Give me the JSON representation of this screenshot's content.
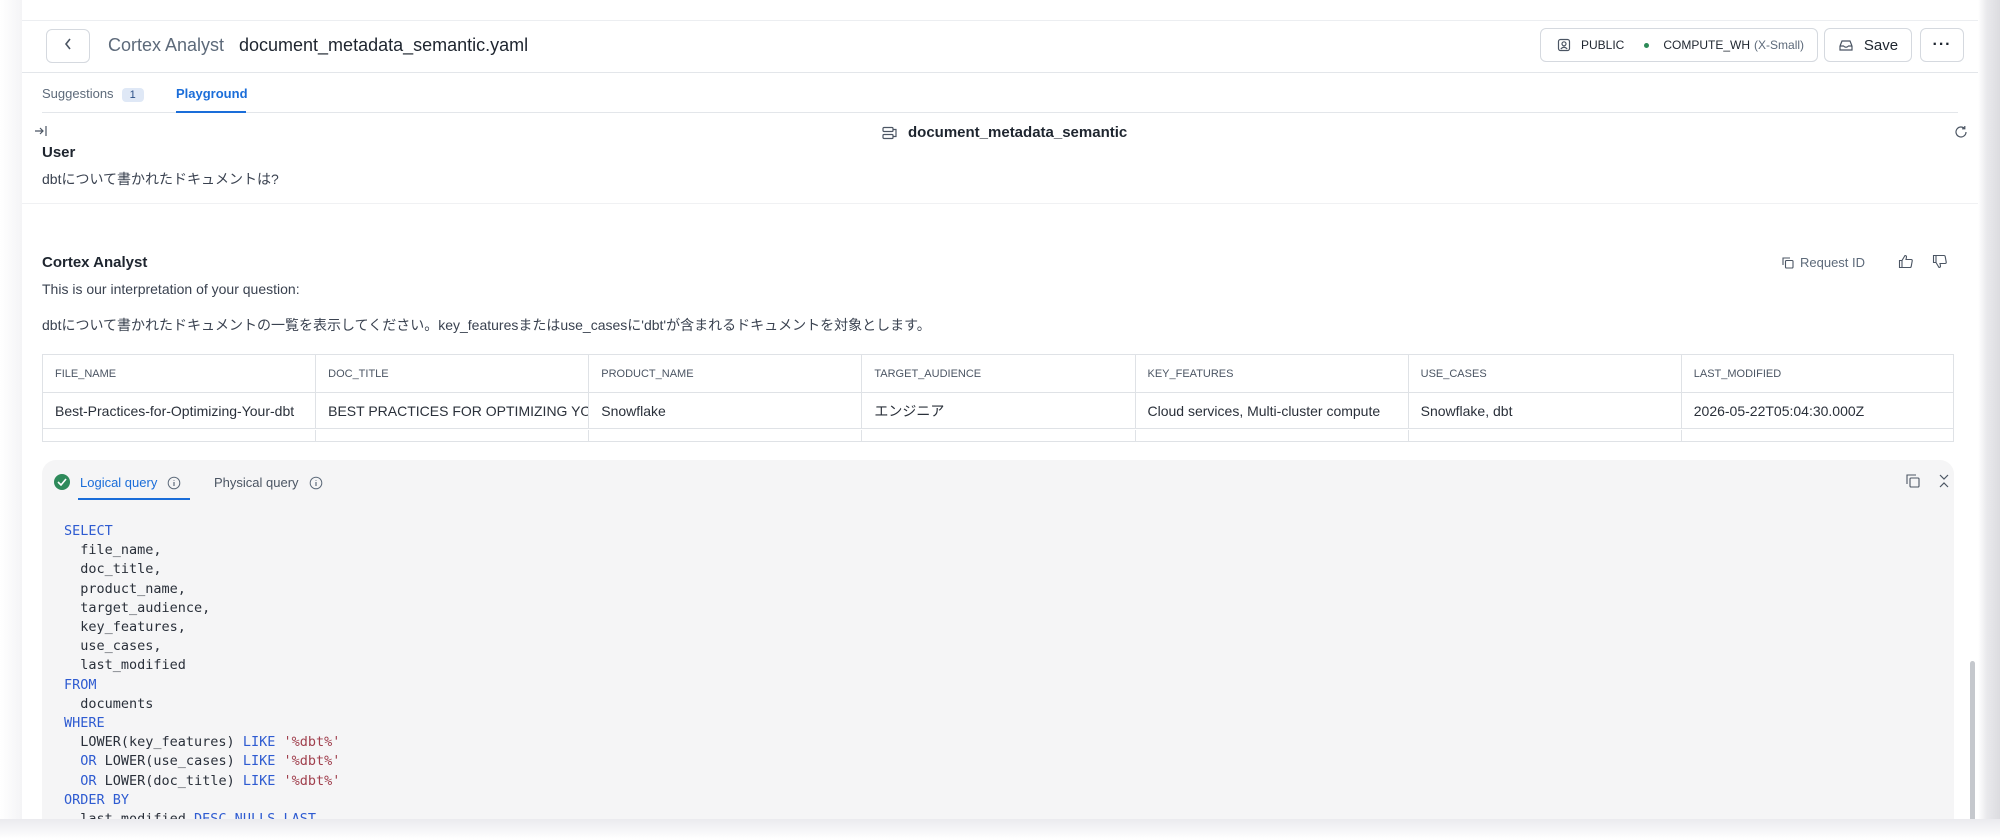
{
  "header": {
    "app_name": "Cortex Analyst",
    "file_name": "document_metadata_semantic.yaml",
    "role": "PUBLIC",
    "warehouse": "COMPUTE_WH",
    "warehouse_size": "(X-Small)",
    "save_label": "Save",
    "more_label": "···",
    "icons": [
      "chevron-left-icon",
      "user-role-icon",
      "save-icon",
      "more-icon"
    ]
  },
  "tabs": {
    "suggestions": "Suggestions",
    "suggestions_count": "1",
    "playground": "Playground",
    "active": "Playground"
  },
  "playground": {
    "model_name": "document_metadata_semantic",
    "icons": [
      "collapse-panel-icon",
      "semantic-model-icon",
      "refresh-icon"
    ]
  },
  "conversation": {
    "user_label": "User",
    "user_message": "dbtについて書かれたドキュメントは?",
    "assistant_label": "Cortex Analyst",
    "request_id_label": "Request ID",
    "interpretation_intro": "This is our interpretation of your question:",
    "interpretation": "dbtについて書かれたドキュメントの一覧を表示してください。key_featuresまたはuse_casesに'dbt'が含まれるドキュメントを対象とします。"
  },
  "results": {
    "columns": [
      "FILE_NAME",
      "DOC_TITLE",
      "PRODUCT_NAME",
      "TARGET_AUDIENCE",
      "KEY_FEATURES",
      "USE_CASES",
      "LAST_MODIFIED"
    ],
    "rows": [
      [
        "Best-Practices-for-Optimizing-Your-dbt",
        "BEST PRACTICES FOR OPTIMIZING YOUR DBT",
        "Snowflake",
        "エンジニア",
        "Cloud services, Multi-cluster compute",
        "Snowflake, dbt",
        "2026-05-22T05:04:30.000Z"
      ]
    ]
  },
  "query": {
    "logical_tab": "Logical query",
    "physical_tab": "Physical query",
    "active_tab": "Logical query",
    "lines": [
      [
        {
          "t": "SELECT",
          "c": "kw"
        }
      ],
      [
        {
          "t": "  file_name,",
          "c": ""
        }
      ],
      [
        {
          "t": "  doc_title,",
          "c": ""
        }
      ],
      [
        {
          "t": "  product_name,",
          "c": ""
        }
      ],
      [
        {
          "t": "  target_audience,",
          "c": ""
        }
      ],
      [
        {
          "t": "  key_features,",
          "c": ""
        }
      ],
      [
        {
          "t": "  use_cases,",
          "c": ""
        }
      ],
      [
        {
          "t": "  last_modified",
          "c": ""
        }
      ],
      [
        {
          "t": "FROM",
          "c": "kw"
        }
      ],
      [
        {
          "t": "  documents",
          "c": ""
        }
      ],
      [
        {
          "t": "WHERE",
          "c": "kw"
        }
      ],
      [
        {
          "t": "  LOWER(key_features) ",
          "c": ""
        },
        {
          "t": "LIKE",
          "c": "kw"
        },
        {
          "t": " ",
          "c": ""
        },
        {
          "t": "'%dbt%'",
          "c": "str"
        }
      ],
      [
        {
          "t": "  ",
          "c": ""
        },
        {
          "t": "OR",
          "c": "kw"
        },
        {
          "t": " LOWER(use_cases) ",
          "c": ""
        },
        {
          "t": "LIKE",
          "c": "kw"
        },
        {
          "t": " ",
          "c": ""
        },
        {
          "t": "'%dbt%'",
          "c": "str"
        }
      ],
      [
        {
          "t": "  ",
          "c": ""
        },
        {
          "t": "OR",
          "c": "kw"
        },
        {
          "t": " LOWER(doc_title) ",
          "c": ""
        },
        {
          "t": "LIKE",
          "c": "kw"
        },
        {
          "t": " ",
          "c": ""
        },
        {
          "t": "'%dbt%'",
          "c": "str"
        }
      ],
      [
        {
          "t": "ORDER BY",
          "c": "kw"
        }
      ],
      [
        {
          "t": "  last_modified ",
          "c": ""
        },
        {
          "t": "DESC NULLS LAST",
          "c": "kw"
        }
      ]
    ]
  },
  "colors": {
    "accent": "#1a6dd9",
    "success": "#2e8a5b",
    "keyword": "#2e5bd1",
    "string": "#a03f4d"
  }
}
